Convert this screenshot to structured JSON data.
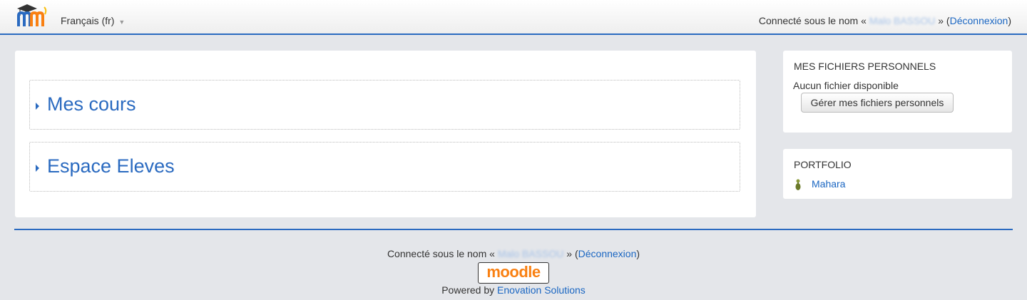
{
  "header": {
    "language": "Français (fr)",
    "login_prefix": "Connecté sous le nom «",
    "user_name": "Malo BASSOU",
    "login_middle": "» (",
    "logout_label": "Déconnexion",
    "login_suffix": ")"
  },
  "categories": [
    {
      "label": "Mes cours"
    },
    {
      "label": "Espace Eleves"
    }
  ],
  "private_files": {
    "heading": "MES FICHIERS PERSONNELS",
    "empty_text": "Aucun fichier disponible",
    "manage_button": "Gérer mes fichiers personnels"
  },
  "portfolio": {
    "heading": "PORTFOLIO",
    "link": "Mahara"
  },
  "footer": {
    "login_prefix": "Connecté sous le nom «",
    "user_name": "Malo BASSOU",
    "login_middle": "» (",
    "logout_label": "Déconnexion",
    "login_suffix": ")",
    "badge_text": "moodle",
    "powered_prefix": "Powered by ",
    "powered_link": "Enovation Solutions"
  },
  "colors": {
    "accent": "#2a6ac0",
    "link": "#1a66c2",
    "background": "#e4e6ea",
    "moodle_orange": "#f98012"
  }
}
